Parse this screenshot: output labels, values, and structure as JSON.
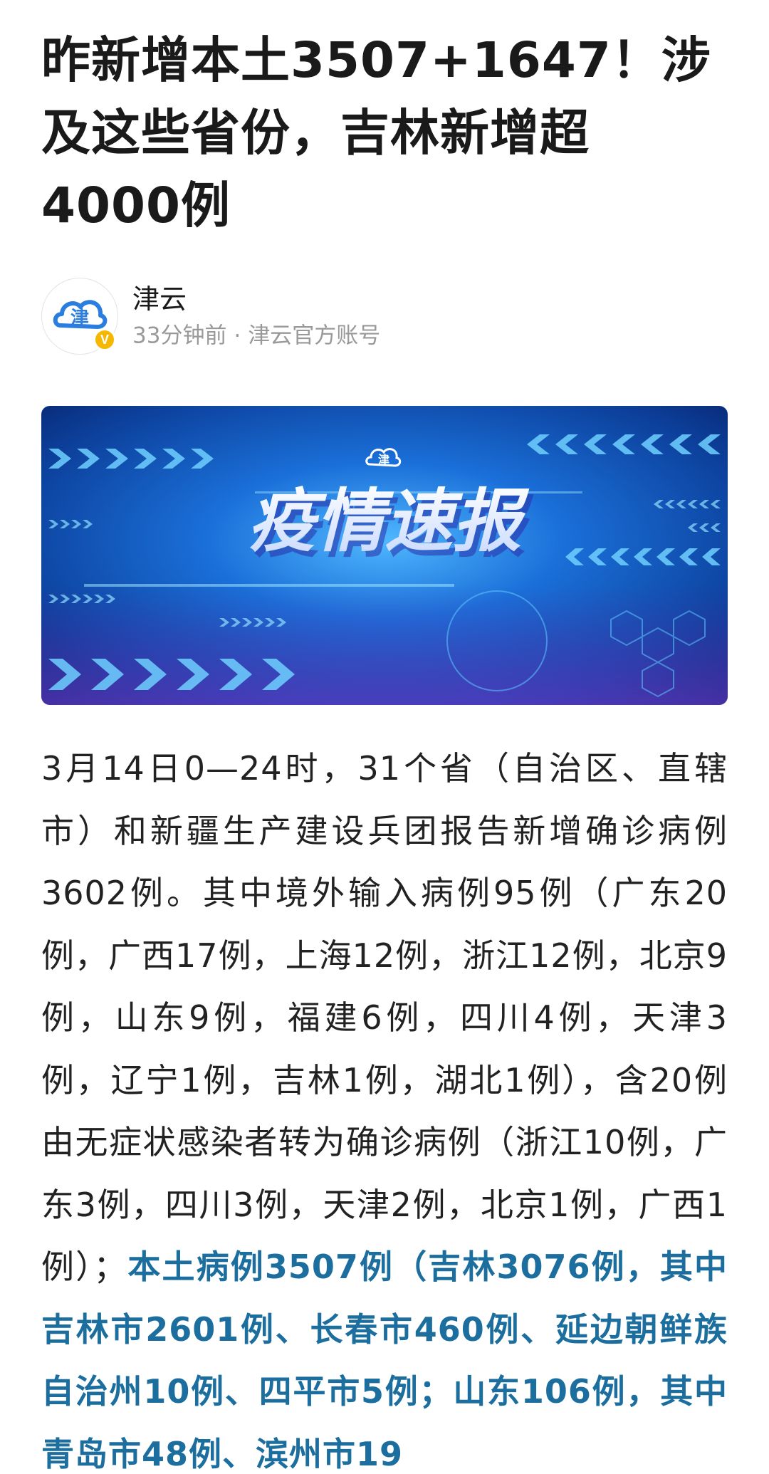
{
  "article": {
    "title": "昨新增本土3507+1647！涉及这些省份，吉林新增超4000例",
    "author": {
      "name": "津云",
      "time": "33分钟前",
      "separator": "·",
      "account_type": "津云官方账号",
      "verified_badge": "V",
      "avatar_icon": "jinyun-logo-icon"
    },
    "banner": {
      "headline": "疫情速报",
      "logo_text": "津",
      "accent_color": "#1e7fd6"
    },
    "body": {
      "intro": "3月14日0—24时，31个省（自治区、直辖市）和新疆生产建设兵团报告新增确诊病例3602例。其中境外输入病例95例（广东20例，广西17例，上海12例，浙江12例，北京9例，山东9例，福建6例，四川4例，天津3例，辽宁1例，吉林1例，湖北1例），含20例由无症状感染者转为确诊病例（浙江10例，广东3例，四川3例，天津2例，北京1例，广西1例）；",
      "highlight": "本土病例3507例（吉林3076例，其中吉林市2601例、长春市460例、延边朝鲜族自治州10例、四平市5例；山东106例，其中青岛市48例、滨州市19",
      "highlight_color": "#1b6e9e"
    }
  }
}
